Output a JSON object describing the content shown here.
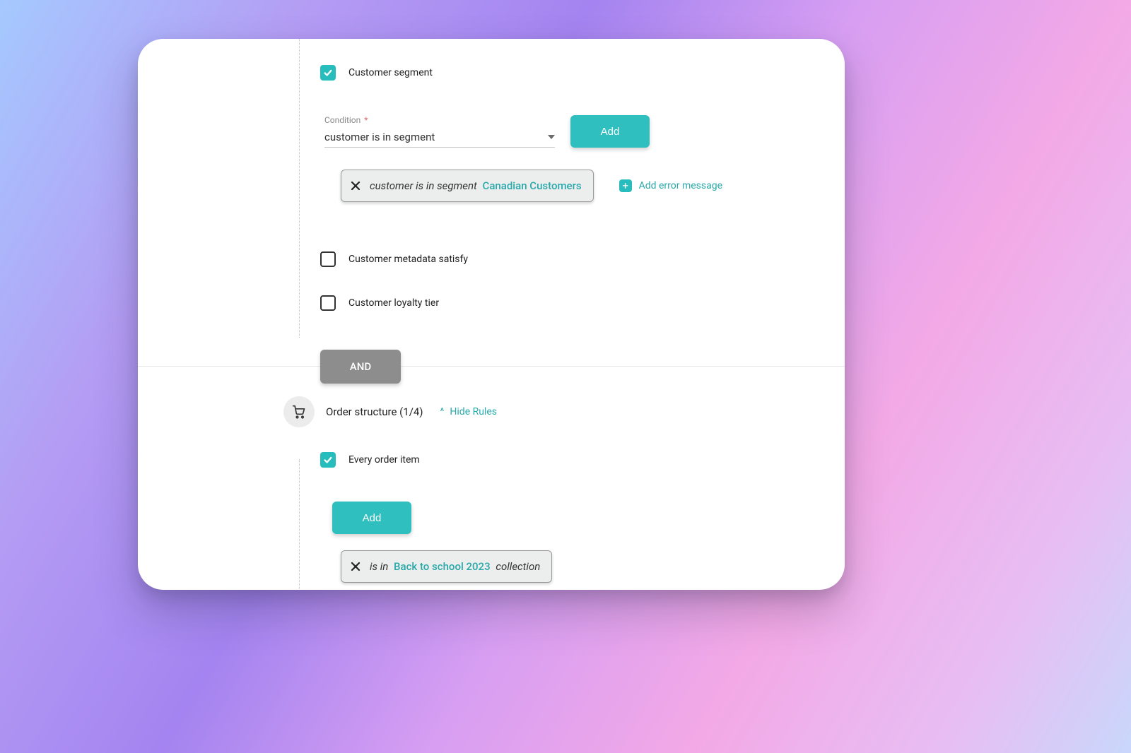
{
  "rules": {
    "customer_segment": {
      "checked": true,
      "label": "Customer segment",
      "condition": {
        "caption": "Condition",
        "required_mark": "*",
        "value": "customer is in segment"
      },
      "add_button": "Add",
      "chip": {
        "prefix": "customer is in segment",
        "segment": "Canadian Customers"
      },
      "add_error_link": "Add error message"
    },
    "customer_metadata": {
      "checked": false,
      "label": "Customer metadata satisfy"
    },
    "customer_loyalty": {
      "checked": false,
      "label": "Customer loyalty tier"
    }
  },
  "connector": "AND",
  "order_section": {
    "title": "Order structure (1/4)",
    "toggle_label": "Hide Rules",
    "every_item": {
      "checked": true,
      "label": "Every order item"
    },
    "add_button": "Add",
    "chip": {
      "prefix": "is in",
      "collection": "Back to school 2023",
      "suffix": "collection"
    }
  }
}
